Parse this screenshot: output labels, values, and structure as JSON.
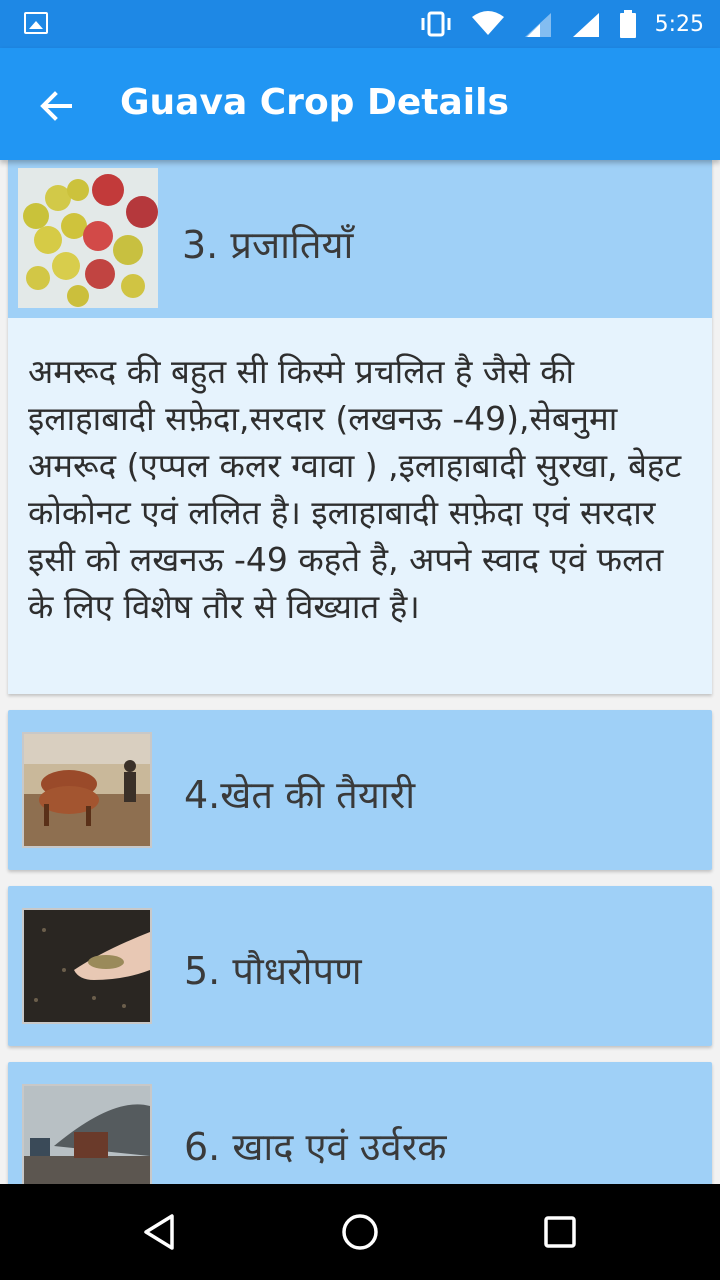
{
  "status_bar": {
    "time": "5:25",
    "icons": [
      "image-icon",
      "vibrate-icon",
      "wifi-icon",
      "signal-icon",
      "signal-full-icon",
      "battery-icon"
    ]
  },
  "app_bar": {
    "title": "Guava Crop Details",
    "back_icon": "arrow-left-icon"
  },
  "sections": [
    {
      "title": "3. प्रजातियाँ",
      "expanded": true,
      "thumbnail": "guava-fruits-image",
      "body": "अमरूद की बहुत सी किस्मे प्रचलित है जैसे की इलाहाबादी सफ़ेदा,सरदार (लखनऊ -49),सेबनुमा अमरूद (एप्पल कलर ग्वावा ) ,इलाहाबादी सुरखा, बेहट कोकोनट एवं ललित है। इलाहाबादी सफ़ेदा एवं सरदार इसी को लखनऊ -49 कहते है, अपने स्वाद एवं फलत के लिए विशेष तौर से विख्यात है।"
    },
    {
      "title": "4.खेत की तैयारी",
      "expanded": false,
      "thumbnail": "oxen-plowing-image"
    },
    {
      "title": "5. पौधरोपण",
      "expanded": false,
      "thumbnail": "seeds-in-hand-image"
    },
    {
      "title": "6. खाद एवं उर्वरक",
      "expanded": false,
      "thumbnail": "fertilizer-spreader-image"
    }
  ],
  "nav_bar": {
    "icons": [
      "back-triangle-icon",
      "home-circle-icon",
      "recents-square-icon"
    ]
  },
  "colors": {
    "status_bar": "#1e88e5",
    "app_bar": "#2196f3",
    "card": "#9fd0f7",
    "card_body": "#e6f3fd"
  }
}
